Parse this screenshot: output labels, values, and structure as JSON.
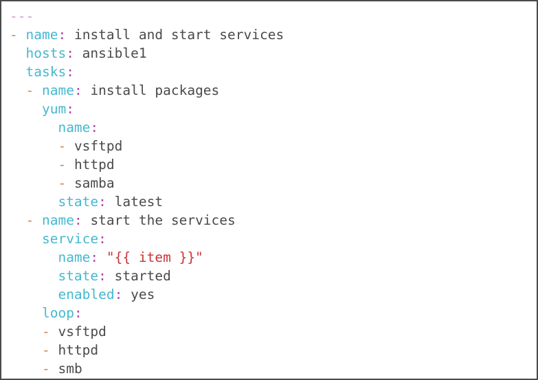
{
  "editor": {
    "language": "yaml",
    "filetype": "ansible-playbook",
    "background_color": "#ffffff",
    "border_color": "#4a4a4a",
    "colors": {
      "document_marker": "#cc99cc",
      "list_dash": "#d4824a",
      "key": "#45b8d0",
      "colon": "#b040b0",
      "value": "#4a4a4a",
      "string": "#cc3333"
    }
  },
  "lines": [
    {
      "indent": 0,
      "tokens": [
        {
          "type": "doc",
          "text": "---"
        }
      ]
    },
    {
      "indent": 0,
      "tokens": [
        {
          "type": "dash",
          "text": "-"
        },
        {
          "type": "plain",
          "text": " "
        },
        {
          "type": "key",
          "text": "name"
        },
        {
          "type": "colon",
          "text": ":"
        },
        {
          "type": "val",
          "text": " install and start services"
        }
      ]
    },
    {
      "indent": 2,
      "tokens": [
        {
          "type": "key",
          "text": "hosts"
        },
        {
          "type": "colon",
          "text": ":"
        },
        {
          "type": "val",
          "text": " ansible1"
        }
      ]
    },
    {
      "indent": 2,
      "tokens": [
        {
          "type": "key",
          "text": "tasks"
        },
        {
          "type": "colon",
          "text": ":"
        }
      ]
    },
    {
      "indent": 2,
      "tokens": [
        {
          "type": "dash",
          "text": "-"
        },
        {
          "type": "plain",
          "text": " "
        },
        {
          "type": "key",
          "text": "name"
        },
        {
          "type": "colon",
          "text": ":"
        },
        {
          "type": "val",
          "text": " install packages"
        }
      ]
    },
    {
      "indent": 4,
      "tokens": [
        {
          "type": "key",
          "text": "yum"
        },
        {
          "type": "colon",
          "text": ":"
        }
      ]
    },
    {
      "indent": 6,
      "tokens": [
        {
          "type": "key",
          "text": "name"
        },
        {
          "type": "colon",
          "text": ":"
        }
      ]
    },
    {
      "indent": 6,
      "tokens": [
        {
          "type": "dash",
          "text": "-"
        },
        {
          "type": "val",
          "text": " vsftpd"
        }
      ]
    },
    {
      "indent": 6,
      "tokens": [
        {
          "type": "dash",
          "text": "-"
        },
        {
          "type": "val",
          "text": " httpd"
        }
      ]
    },
    {
      "indent": 6,
      "tokens": [
        {
          "type": "dash",
          "text": "-"
        },
        {
          "type": "val",
          "text": " samba"
        }
      ]
    },
    {
      "indent": 6,
      "tokens": [
        {
          "type": "key",
          "text": "state"
        },
        {
          "type": "colon",
          "text": ":"
        },
        {
          "type": "val",
          "text": " latest"
        }
      ]
    },
    {
      "indent": 2,
      "tokens": [
        {
          "type": "dash",
          "text": "-"
        },
        {
          "type": "plain",
          "text": " "
        },
        {
          "type": "key",
          "text": "name"
        },
        {
          "type": "colon",
          "text": ":"
        },
        {
          "type": "val",
          "text": " start the services"
        }
      ]
    },
    {
      "indent": 4,
      "tokens": [
        {
          "type": "key",
          "text": "service"
        },
        {
          "type": "colon",
          "text": ":"
        }
      ]
    },
    {
      "indent": 6,
      "tokens": [
        {
          "type": "key",
          "text": "name"
        },
        {
          "type": "colon",
          "text": ":"
        },
        {
          "type": "plain",
          "text": " "
        },
        {
          "type": "str",
          "text": "\"{{ item }}\""
        }
      ]
    },
    {
      "indent": 6,
      "tokens": [
        {
          "type": "key",
          "text": "state"
        },
        {
          "type": "colon",
          "text": ":"
        },
        {
          "type": "val",
          "text": " started"
        }
      ]
    },
    {
      "indent": 6,
      "tokens": [
        {
          "type": "key",
          "text": "enabled"
        },
        {
          "type": "colon",
          "text": ":"
        },
        {
          "type": "val",
          "text": " yes"
        }
      ]
    },
    {
      "indent": 4,
      "tokens": [
        {
          "type": "key",
          "text": "loop"
        },
        {
          "type": "colon",
          "text": ":"
        }
      ]
    },
    {
      "indent": 4,
      "tokens": [
        {
          "type": "dash",
          "text": "-"
        },
        {
          "type": "val",
          "text": " vsftpd"
        }
      ]
    },
    {
      "indent": 4,
      "tokens": [
        {
          "type": "dash",
          "text": "-"
        },
        {
          "type": "val",
          "text": " httpd"
        }
      ]
    },
    {
      "indent": 4,
      "tokens": [
        {
          "type": "dash",
          "text": "-"
        },
        {
          "type": "val",
          "text": " smb"
        }
      ]
    }
  ]
}
